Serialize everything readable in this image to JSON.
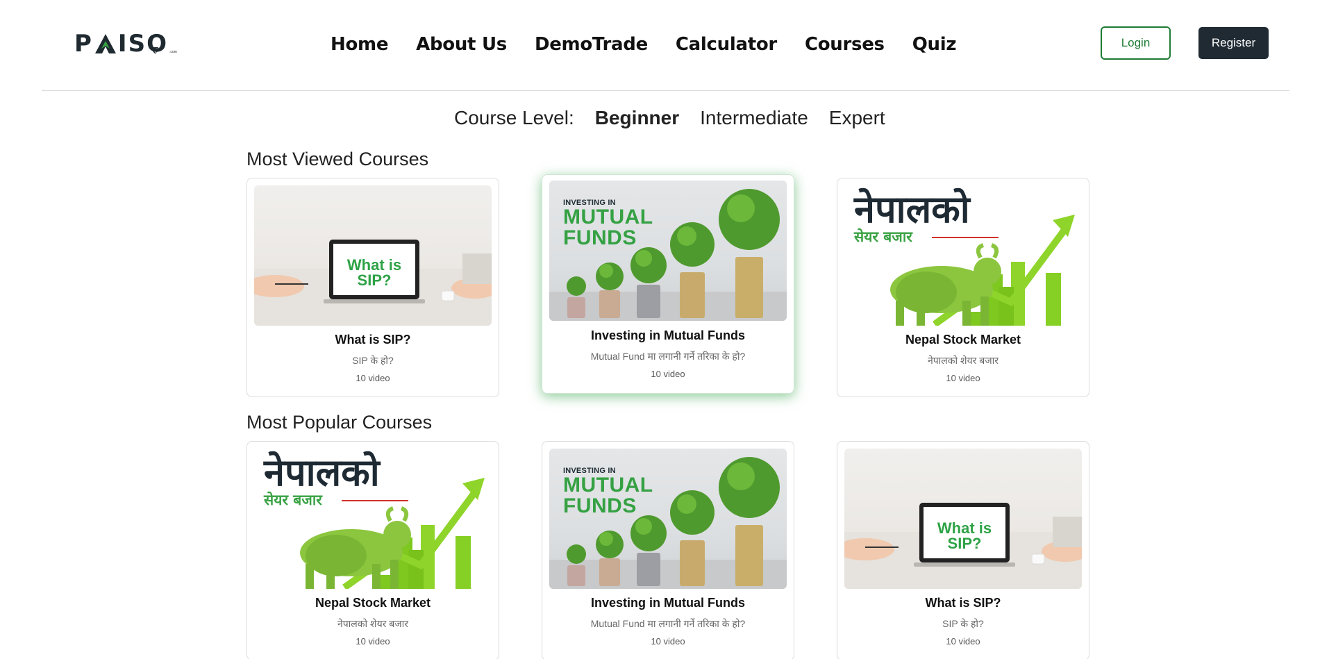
{
  "brand": {
    "logo_left": "P",
    "logo_right": "IS",
    "logo_o": "O",
    "logo_rupee": "रु",
    "logo_com": ".com"
  },
  "nav": {
    "items": [
      {
        "label": "Home"
      },
      {
        "label": "About Us"
      },
      {
        "label": "DemoTrade"
      },
      {
        "label": "Calculator"
      },
      {
        "label": "Courses"
      },
      {
        "label": "Quiz"
      }
    ],
    "login_label": "Login",
    "register_label": "Register"
  },
  "levels": {
    "label": "Course Level:",
    "options": [
      {
        "label": "Beginner",
        "active": true
      },
      {
        "label": "Intermediate",
        "active": false
      },
      {
        "label": "Expert",
        "active": false
      }
    ]
  },
  "sections": [
    {
      "title": "Most Viewed Courses",
      "cards": [
        {
          "title": "What is SIP?",
          "subtitle": "SIP के हो?",
          "count": "10 video",
          "thumb": "sip"
        },
        {
          "title": "Investing in Mutual Funds",
          "subtitle": "Mutual Fund मा लगानी गर्ने तरिका के हो?",
          "count": "10 video",
          "thumb": "mf",
          "featured": true
        },
        {
          "title": "Nepal Stock Market",
          "subtitle": "नेपालको शेयर बजार",
          "count": "10 video",
          "thumb": "nepal"
        }
      ]
    },
    {
      "title": "Most Popular Courses",
      "cards": [
        {
          "title": "Nepal Stock Market",
          "subtitle": "नेपालको शेयर बजार",
          "count": "10 video",
          "thumb": "nepal"
        },
        {
          "title": "Investing in Mutual Funds",
          "subtitle": "Mutual Fund मा लगानी गर्ने तरिका के हो?",
          "count": "10 video",
          "thumb": "mf"
        },
        {
          "title": "What is SIP?",
          "subtitle": "SIP के हो?",
          "count": "10 video",
          "thumb": "sip"
        }
      ]
    }
  ],
  "thumbs": {
    "sip_line1": "What is",
    "sip_line2": "SIP?",
    "mf_small": "INVESTING IN",
    "mf_line1": "MUTUAL",
    "mf_line2": "FUNDS",
    "nepal_big": "नेपालको",
    "nepal_small": "सेयर बजार"
  },
  "colors": {
    "brand_green": "#35a143",
    "dark": "#1f2a33",
    "login_border": "#1e7b34"
  }
}
